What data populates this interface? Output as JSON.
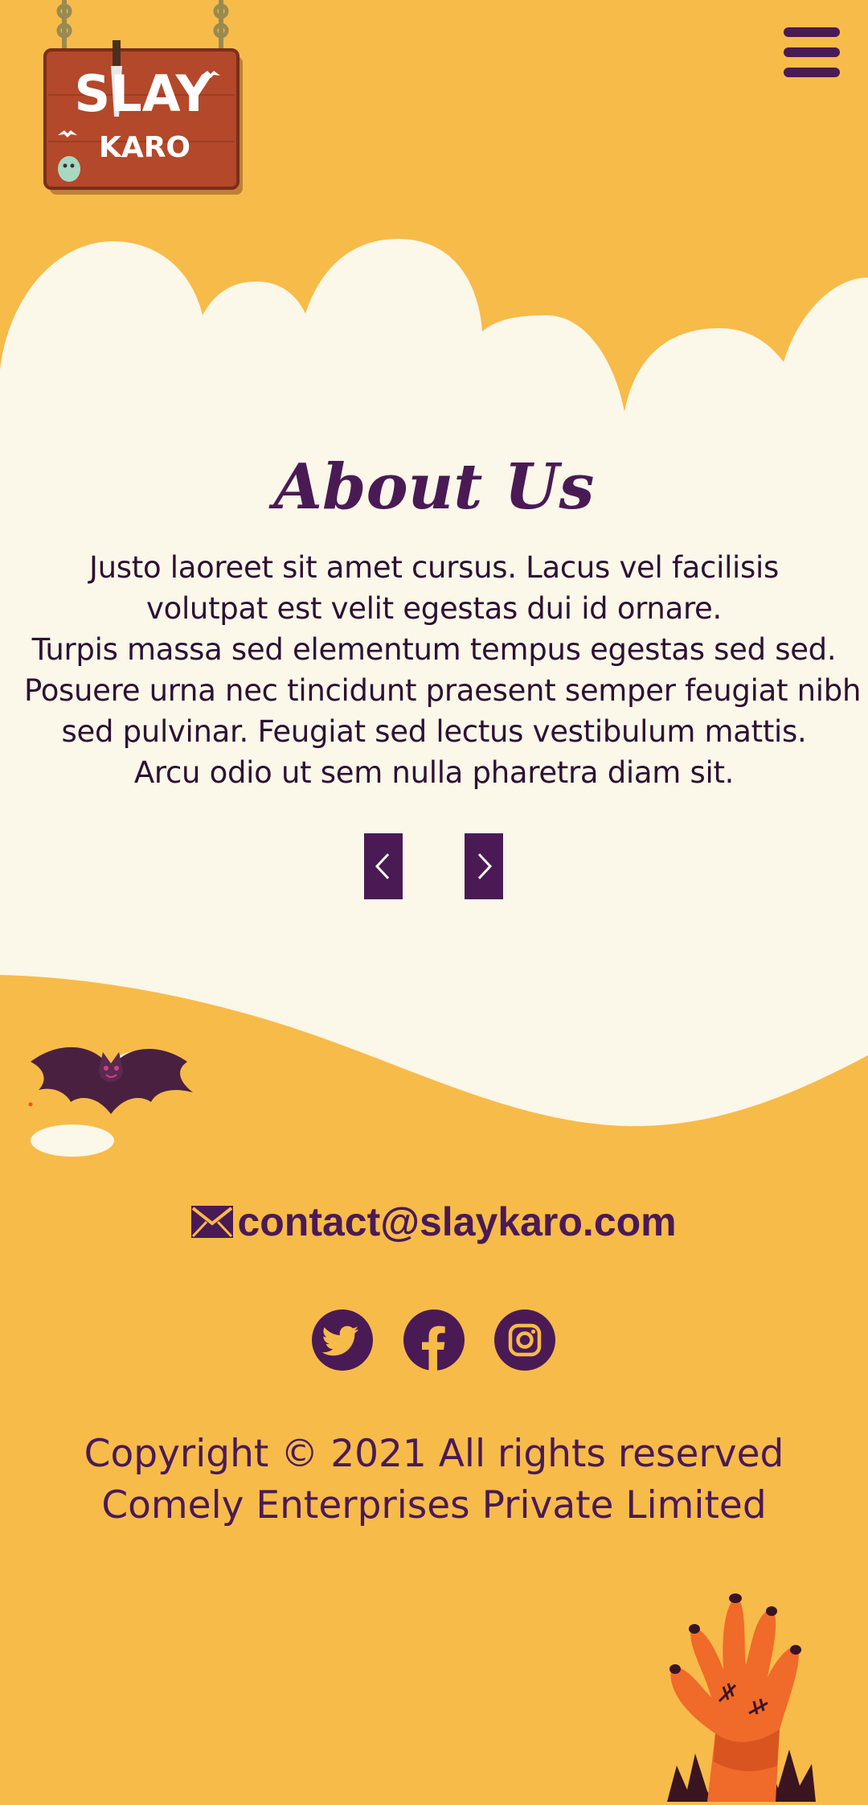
{
  "logo": {
    "line1": "SLAY",
    "line2": "KARO"
  },
  "menu": {
    "icon": "hamburger-icon"
  },
  "about": {
    "title": "About Us",
    "lines": [
      "Justo laoreet sit amet cursus. Lacus vel facilisis",
      "volutpat est velit egestas dui id ornare.",
      "Turpis massa sed elementum tempus egestas sed sed.",
      "Posuere urna nec tincidunt praesent semper feugiat nibh",
      "sed pulvinar. Feugiat sed lectus vestibulum mattis.",
      "Arcu odio ut sem nulla pharetra diam sit."
    ],
    "prev_icon": "chevron-left-icon",
    "next_icon": "chevron-right-icon"
  },
  "contact": {
    "email": "contact@slaykaro.com",
    "icon": "envelope-icon"
  },
  "social": [
    {
      "name": "twitter",
      "icon": "twitter-icon"
    },
    {
      "name": "facebook",
      "icon": "facebook-icon"
    },
    {
      "name": "instagram",
      "icon": "instagram-icon"
    }
  ],
  "footer": {
    "copyright_line1": "Copyright © 2021 All rights reserved",
    "copyright_line2": "Comely Enterprises Private Limited"
  },
  "colors": {
    "background": "#F7BB4A",
    "cream": "#FBF7E9",
    "purple": "#4A1A55",
    "text_dark": "#2D1133"
  }
}
